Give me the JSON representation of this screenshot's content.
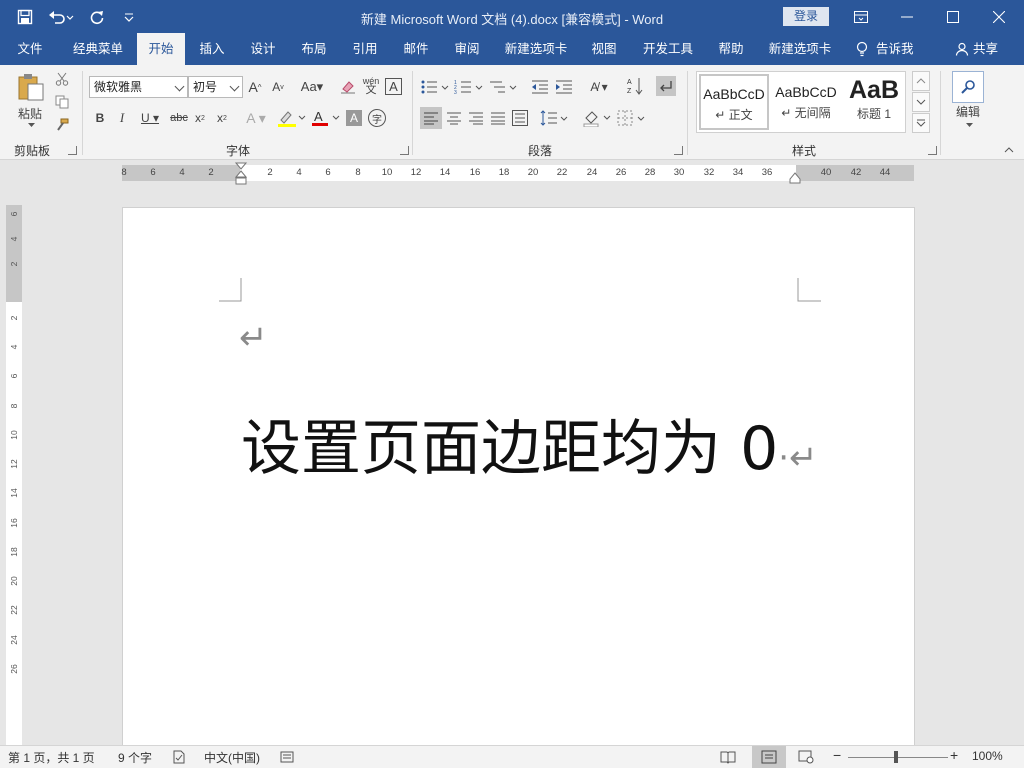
{
  "titlebar": {
    "title": "新建 Microsoft Word 文档 (4).docx [兼容模式]  -  Word",
    "login": "登录"
  },
  "tabs": [
    {
      "label": "文件",
      "active": false
    },
    {
      "label": "经典菜单",
      "active": false
    },
    {
      "label": "开始",
      "active": true
    },
    {
      "label": "插入",
      "active": false
    },
    {
      "label": "设计",
      "active": false
    },
    {
      "label": "布局",
      "active": false
    },
    {
      "label": "引用",
      "active": false
    },
    {
      "label": "邮件",
      "active": false
    },
    {
      "label": "审阅",
      "active": false
    },
    {
      "label": "新建选项卡",
      "active": false
    },
    {
      "label": "视图",
      "active": false
    },
    {
      "label": "开发工具",
      "active": false
    },
    {
      "label": "帮助",
      "active": false
    },
    {
      "label": "新建选项卡",
      "active": false
    }
  ],
  "tell_me": "告诉我",
  "share": "共享",
  "ribbon": {
    "clipboard": {
      "label": "剪贴板",
      "paste": "粘贴"
    },
    "font": {
      "label": "字体",
      "font_name": "微软雅黑",
      "font_size": "初号"
    },
    "paragraph": {
      "label": "段落"
    },
    "styles": {
      "label": "样式",
      "items": [
        {
          "sample": "AaBbCcD",
          "name": "↵ 正文"
        },
        {
          "sample": "AaBbCcD",
          "name": "↵ 无间隔"
        },
        {
          "sample": "AaB",
          "name": "标题 1"
        }
      ]
    },
    "editing": {
      "label": "编辑"
    }
  },
  "ruler": {
    "labels": [
      "8",
      "6",
      "4",
      "2",
      "2",
      "4",
      "6",
      "8",
      "10",
      "12",
      "14",
      "16",
      "18",
      "20",
      "22",
      "24",
      "26",
      "28",
      "30",
      "32",
      "34",
      "36",
      "40",
      "42",
      "44"
    ],
    "vlabels": [
      "6",
      "4",
      "2",
      "2",
      "4",
      "6",
      "8",
      "10",
      "12",
      "14",
      "16",
      "18",
      "20",
      "22",
      "24",
      "26"
    ]
  },
  "document": {
    "line1": "↵",
    "text": "设置页面边距均为 0",
    "end_mark": "·↵"
  },
  "statusbar": {
    "page": "第 1 页，共 1 页",
    "words": "9 个字",
    "language": "中文(中国)",
    "zoom": "100%"
  },
  "colors": {
    "accent": "#2b579a",
    "ribbon_bg": "#f3f3f3"
  }
}
